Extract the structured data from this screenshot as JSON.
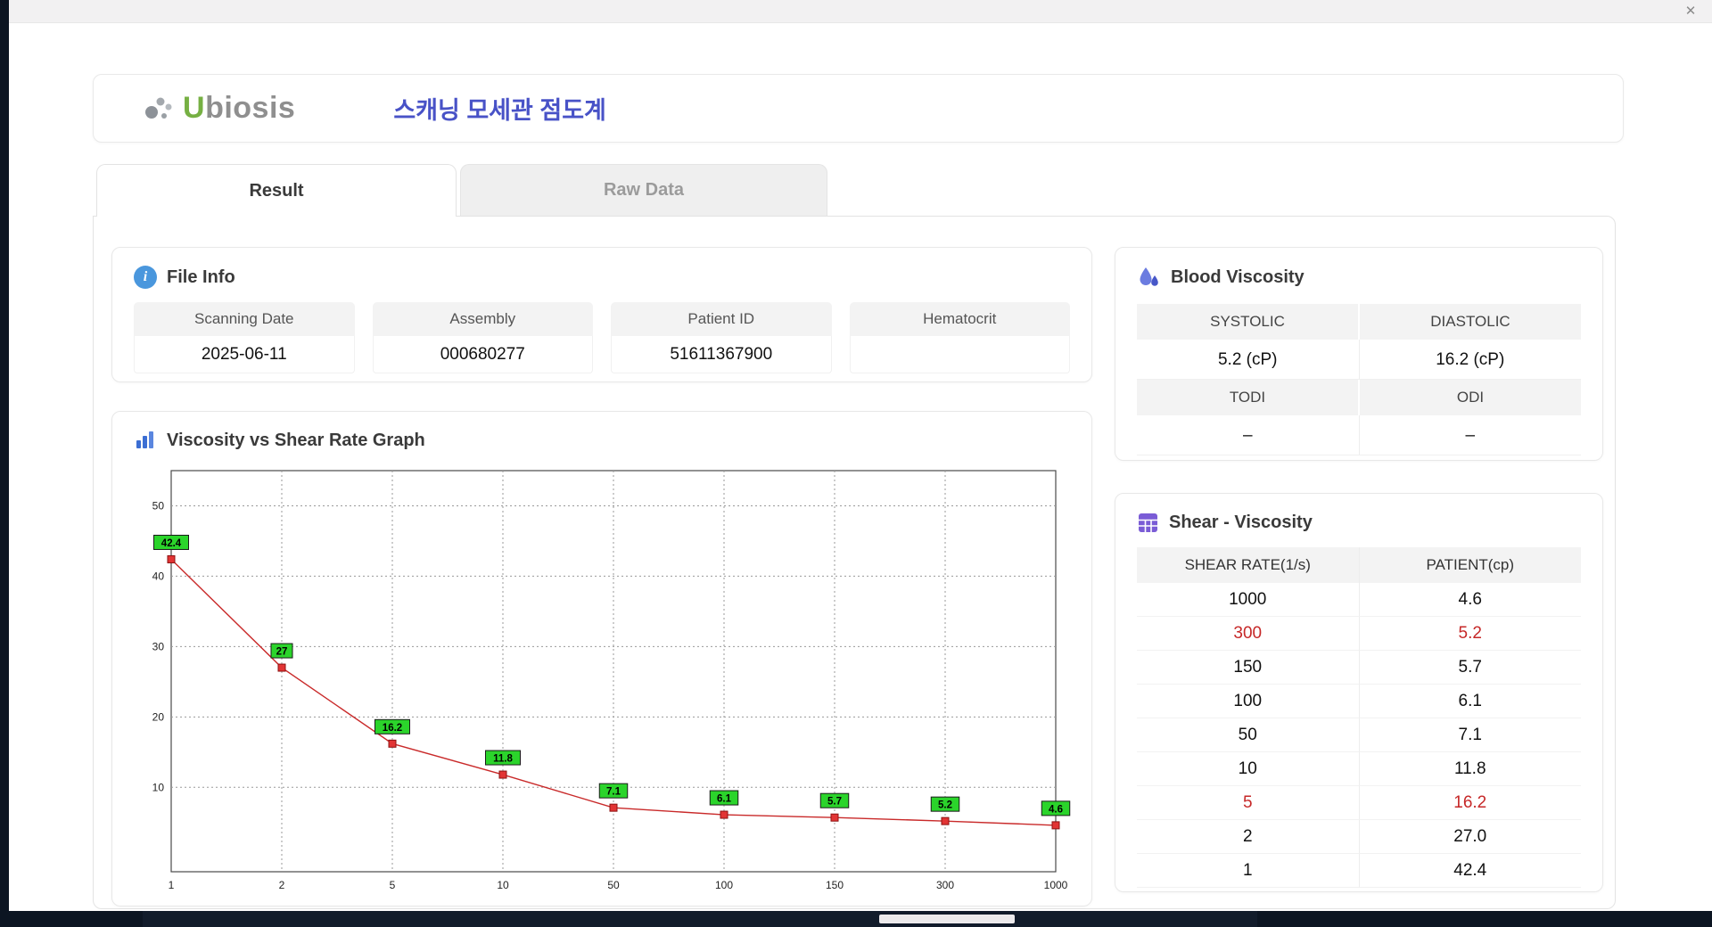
{
  "window": {
    "close_glyph": "✕"
  },
  "header": {
    "logo_accent": "U",
    "logo_rest": "biosis",
    "title": "스캐닝 모세관 점도계"
  },
  "tabs": [
    {
      "label": "Result",
      "active": true
    },
    {
      "label": "Raw Data",
      "active": false
    }
  ],
  "file_info": {
    "title": "File Info",
    "fields": [
      {
        "label": "Scanning Date",
        "value": "2025-06-11"
      },
      {
        "label": "Assembly",
        "value": "000680277"
      },
      {
        "label": "Patient ID",
        "value": "51611367900"
      },
      {
        "label": "Hematocrit",
        "value": ""
      }
    ]
  },
  "blood_viscosity": {
    "title": "Blood Viscosity",
    "rows": [
      {
        "headers": [
          "SYSTOLIC",
          "DIASTOLIC"
        ],
        "values": [
          "5.2 (cP)",
          "16.2 (cP)"
        ]
      },
      {
        "headers": [
          "TODI",
          "ODI"
        ],
        "values": [
          "–",
          "–"
        ]
      }
    ]
  },
  "graph": {
    "title": "Viscosity vs Shear Rate Graph"
  },
  "chart_data": {
    "type": "line",
    "title": "Viscosity vs Shear Rate Graph",
    "x_categories": [
      "1",
      "2",
      "5",
      "10",
      "50",
      "100",
      "150",
      "300",
      "1000"
    ],
    "values": [
      42.4,
      27,
      16.2,
      11.8,
      7.1,
      6.1,
      5.7,
      5.2,
      4.6
    ],
    "point_labels": [
      "42.4",
      "27",
      "16.2",
      "11.8",
      "7.1",
      "6.1",
      "5.7",
      "5.2",
      "4.6"
    ],
    "xlabel": "",
    "ylabel": "",
    "x_scale": "categorical",
    "yticks": [
      10,
      20,
      30,
      40,
      50
    ],
    "ylim": [
      -2,
      55
    ],
    "grid": "dotted",
    "legend": "none",
    "line_color": "#c92a2a",
    "marker": "square",
    "marker_color": "#e23434",
    "marker_edge": "#8d1212",
    "label_bg": "#2bd42b",
    "label_border": "#1a1a1a"
  },
  "shear_table": {
    "title": "Shear - Viscosity",
    "columns": [
      "SHEAR RATE(1/s)",
      "PATIENT(cp)"
    ],
    "rows": [
      {
        "shear": "1000",
        "patient": "4.6",
        "highlight": false
      },
      {
        "shear": "300",
        "patient": "5.2",
        "highlight": true
      },
      {
        "shear": "150",
        "patient": "5.7",
        "highlight": false
      },
      {
        "shear": "100",
        "patient": "6.1",
        "highlight": false
      },
      {
        "shear": "50",
        "patient": "7.1",
        "highlight": false
      },
      {
        "shear": "10",
        "patient": "11.8",
        "highlight": false
      },
      {
        "shear": "5",
        "patient": "16.2",
        "highlight": true
      },
      {
        "shear": "2",
        "patient": "27.0",
        "highlight": false
      },
      {
        "shear": "1",
        "patient": "42.4",
        "highlight": false
      }
    ]
  },
  "colors": {
    "accent_title": "#4852c7",
    "logo_green": "#76b043",
    "highlight_red": "#c62828",
    "info_blue": "#4a97dd",
    "droplet_purple": "#5b6bd8",
    "table_icon_purple": "#7a5cd6"
  }
}
